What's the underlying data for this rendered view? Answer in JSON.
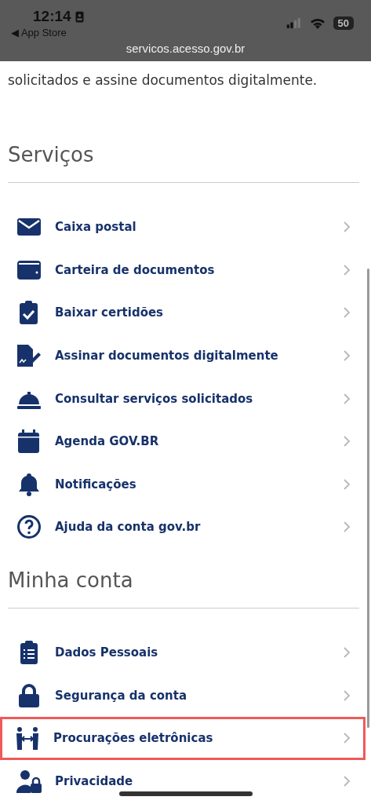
{
  "status_bar": {
    "time": "12:14",
    "back_label": "◀ App Store",
    "url": "servicos.acesso.gov.br",
    "battery": "50"
  },
  "intro": "solicitados e assine documentos digitalmente.",
  "sections": [
    {
      "title": "Serviços",
      "items": [
        {
          "kind": "mail",
          "label": "Caixa postal",
          "highlighted": false
        },
        {
          "kind": "wallet",
          "label": "Carteira de documentos",
          "highlighted": false
        },
        {
          "kind": "certificate",
          "label": "Baixar certidões",
          "highlighted": false
        },
        {
          "kind": "signature",
          "label": "Assinar documentos digitalmente",
          "highlighted": false
        },
        {
          "kind": "service",
          "label": "Consultar serviços solicitados",
          "highlighted": false
        },
        {
          "kind": "calendar",
          "label": "Agenda GOV.BR",
          "highlighted": false
        },
        {
          "kind": "notification",
          "label": "Notificações",
          "highlighted": false
        },
        {
          "kind": "help",
          "label": "Ajuda da conta gov.br",
          "highlighted": false
        }
      ]
    },
    {
      "title": "Minha conta",
      "items": [
        {
          "kind": "personal",
          "label": "Dados Pessoais",
          "highlighted": false
        },
        {
          "kind": "security",
          "label": "Segurança da conta",
          "highlighted": false
        },
        {
          "kind": "proxy",
          "label": "Procurações eletrônicas",
          "highlighted": true
        },
        {
          "kind": "privacy",
          "label": "Privacidade",
          "highlighted": false
        }
      ]
    }
  ]
}
